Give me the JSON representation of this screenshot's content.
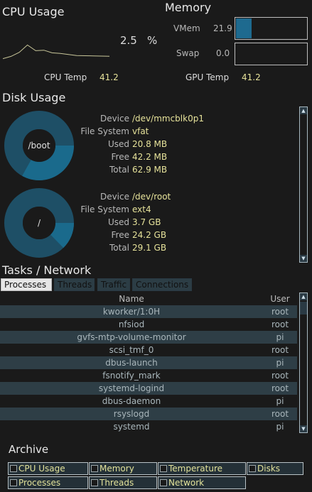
{
  "cpu": {
    "title": "CPU Usage",
    "usage_value": "2.5",
    "usage_unit": "%",
    "temp_label": "CPU Temp",
    "temp_value": "41.2",
    "history": [
      0.6,
      2.0,
      4.5,
      9.0,
      5.5,
      5.8,
      4.2,
      3.8,
      3.2,
      2.5,
      2.4,
      2.3,
      2.2,
      2.1
    ]
  },
  "memory": {
    "title": "Memory",
    "vmem_label": "VMem",
    "vmem_value": "21.9",
    "vmem_fraction": 0.219,
    "swap_label": "Swap",
    "swap_value": "0.0",
    "swap_fraction": 0.0,
    "gpu_temp_label": "GPU Temp",
    "gpu_temp_value": "41.2"
  },
  "disk": {
    "title": "Disk Usage",
    "labels": {
      "device": "Device",
      "fs": "File System",
      "used": "Used",
      "free": "Free",
      "total": "Total"
    },
    "disks": [
      {
        "mount": "/boot",
        "device": "/dev/mmcblk0p1",
        "fs": "vfat",
        "used": "20.8 MB",
        "free": "42.2 MB",
        "total": "62.9 MB",
        "used_fraction": 0.331
      },
      {
        "mount": "/",
        "device": "/dev/root",
        "fs": "ext4",
        "used": "3.7 GB",
        "free": "24.2 GB",
        "total": "29.1 GB",
        "used_fraction": 0.127
      }
    ]
  },
  "tasks": {
    "title": "Tasks / Network",
    "tabs": [
      "Processes",
      "Threads",
      "Traffic",
      "Connections"
    ],
    "columns": [
      "Name",
      "User"
    ],
    "rows": [
      {
        "name": "kworker/1:0H",
        "user": "root"
      },
      {
        "name": "nfsiod",
        "user": "root"
      },
      {
        "name": "gvfs-mtp-volume-monitor",
        "user": "pi"
      },
      {
        "name": "scsi_tmf_0",
        "user": "root"
      },
      {
        "name": "dbus-launch",
        "user": "pi"
      },
      {
        "name": "fsnotify_mark",
        "user": "root"
      },
      {
        "name": "systemd-logind",
        "user": "root"
      },
      {
        "name": "dbus-daemon",
        "user": "pi"
      },
      {
        "name": "rsyslogd",
        "user": "root"
      },
      {
        "name": "systemd",
        "user": "pi"
      }
    ]
  },
  "archive": {
    "title": "Archive",
    "items": [
      "CPU Usage",
      "Memory",
      "Temperature",
      "Disks",
      "Processes",
      "Threads",
      "Network"
    ]
  },
  "colors": {
    "background": "#1a1a1a",
    "accent": "#1e6a8f",
    "donut_free": "#1e4f66",
    "donut_used": "#1a6a8c",
    "value_text": "#e6e29a",
    "row_alt": "#2e3e46"
  }
}
